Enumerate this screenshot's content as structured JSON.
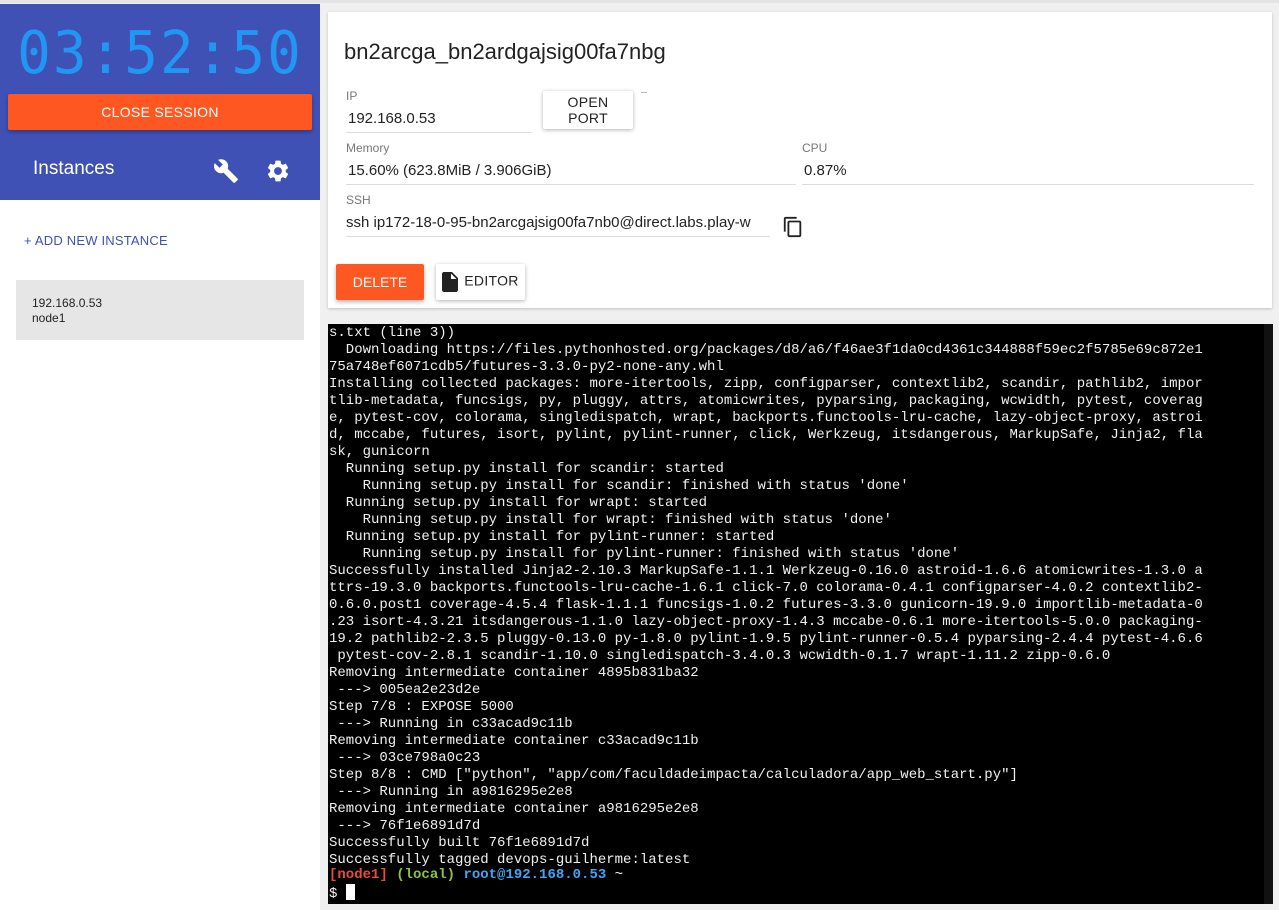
{
  "sidebar": {
    "timer": "03:52:50",
    "close_session_label": "CLOSE SESSION",
    "instances_title": "Instances",
    "add_instance_label": "+ ADD NEW INSTANCE",
    "instances": [
      {
        "ip": "192.168.0.53",
        "name": "node1"
      }
    ]
  },
  "instance": {
    "title": "bn2arcga_bn2ardgajsig00fa7nbg",
    "ip_label": "IP",
    "ip_value": "192.168.0.53",
    "open_port_label": "OPEN PORT",
    "memory_label": "Memory",
    "memory_value": "15.60% (623.8MiB / 3.906GiB)",
    "cpu_label": "CPU",
    "cpu_value": "0.87%",
    "ssh_label": "SSH",
    "ssh_value": "ssh ip172-18-0-95-bn2arcgajsig00fa7nb0@direct.labs.play-w",
    "delete_label": "DELETE",
    "editor_label": "EDITOR"
  },
  "terminal": {
    "lines": [
      "s.txt (line 3))",
      "  Downloading https://files.pythonhosted.org/packages/d8/a6/f46ae3f1da0cd4361c344888f59ec2f5785e69c872e1",
      "75a748ef6071cdb5/futures-3.3.0-py2-none-any.whl",
      "Installing collected packages: more-itertools, zipp, configparser, contextlib2, scandir, pathlib2, impor",
      "tlib-metadata, funcsigs, py, pluggy, attrs, atomicwrites, pyparsing, packaging, wcwidth, pytest, coverag",
      "e, pytest-cov, colorama, singledispatch, wrapt, backports.functools-lru-cache, lazy-object-proxy, astroi",
      "d, mccabe, futures, isort, pylint, pylint-runner, click, Werkzeug, itsdangerous, MarkupSafe, Jinja2, fla",
      "sk, gunicorn",
      "  Running setup.py install for scandir: started",
      "    Running setup.py install for scandir: finished with status 'done'",
      "  Running setup.py install for wrapt: started",
      "    Running setup.py install for wrapt: finished with status 'done'",
      "  Running setup.py install for pylint-runner: started",
      "    Running setup.py install for pylint-runner: finished with status 'done'",
      "Successfully installed Jinja2-2.10.3 MarkupSafe-1.1.1 Werkzeug-0.16.0 astroid-1.6.6 atomicwrites-1.3.0 a",
      "ttrs-19.3.0 backports.functools-lru-cache-1.6.1 click-7.0 colorama-0.4.1 configparser-4.0.2 contextlib2-",
      "0.6.0.post1 coverage-4.5.4 flask-1.1.1 funcsigs-1.0.2 futures-3.3.0 gunicorn-19.9.0 importlib-metadata-0",
      ".23 isort-4.3.21 itsdangerous-1.1.0 lazy-object-proxy-1.4.3 mccabe-0.6.1 more-itertools-5.0.0 packaging-",
      "19.2 pathlib2-2.3.5 pluggy-0.13.0 py-1.8.0 pylint-1.9.5 pylint-runner-0.5.4 pyparsing-2.4.4 pytest-4.6.6",
      " pytest-cov-2.8.1 scandir-1.10.0 singledispatch-3.4.0.3 wcwidth-0.1.7 wrapt-1.11.2 zipp-0.6.0",
      "Removing intermediate container 4895b831ba32",
      " ---> 005ea2e23d2e",
      "Step 7/8 : EXPOSE 5000",
      " ---> Running in c33acad9c11b",
      "Removing intermediate container c33acad9c11b",
      " ---> 03ce798a0c23",
      "Step 8/8 : CMD [\"python\", \"app/com/faculdadeimpacta/calculadora/app_web_start.py\"]",
      " ---> Running in a9816295e2e8",
      "Removing intermediate container a9816295e2e8",
      " ---> 76f1e6891d7d",
      "Successfully built 76f1e6891d7d",
      "Successfully tagged devops-guilherme:latest"
    ],
    "prompt_node": "[node1]",
    "prompt_local": "(local)",
    "prompt_host": "root@192.168.0.53",
    "prompt_dir": " ~",
    "input_prompt": "$ "
  },
  "colors": {
    "sidebar_header": "#3f51b5",
    "timer": "#2196f3",
    "accent": "#ff5722",
    "link": "#3f51b5"
  }
}
